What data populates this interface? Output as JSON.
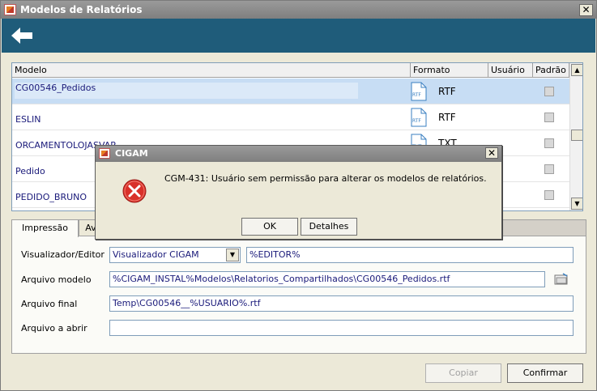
{
  "window": {
    "title": "Modelos de Relatórios",
    "close": "✕"
  },
  "grid": {
    "columns": [
      "Modelo",
      "Formato",
      "Usuário",
      "Padrão"
    ],
    "rows": [
      {
        "model": "CG00546_Pedidos",
        "format": "RTF",
        "selected": true
      },
      {
        "model": "ESLIN",
        "format": "RTF",
        "selected": false
      },
      {
        "model": "ORCAMENTOLOJASVAR",
        "format": "TXT",
        "selected": false
      },
      {
        "model": "Pedido",
        "format": "",
        "selected": false
      },
      {
        "model": "PEDIDO_BRUNO",
        "format": "",
        "selected": false
      }
    ],
    "scroll_up": "▲",
    "scroll_down": "▼"
  },
  "tabs": [
    {
      "label": "Impressão",
      "active": true
    },
    {
      "label": "Av",
      "active": false
    }
  ],
  "form": {
    "viewer_label": "Visualizador/Editor",
    "viewer_value": "Visualizador CIGAM",
    "viewer_arrow": "▼",
    "editor_value": "%EDITOR%",
    "model_file_label": "Arquivo modelo",
    "model_file_value": "%CIGAM_INSTAL%Modelos\\Relatorios_Compartilhados\\CG00546_Pedidos.rtf",
    "final_file_label": "Arquivo final",
    "final_file_value": "Temp\\CG00546__%USUARIO%.rtf",
    "open_file_label": "Arquivo a abrir",
    "open_file_value": ""
  },
  "buttons": {
    "copy": "Copiar",
    "confirm": "Confirmar"
  },
  "dialog": {
    "title": "CIGAM",
    "close": "✕",
    "message": "CGM-431: Usuário sem permissão para alterar os modelos de relatórios.",
    "ok": "OK",
    "details": "Detalhes"
  },
  "colors": {
    "header_band": "#1f5c7a",
    "selected_row": "#c7ddf4",
    "error_red": "#d9302a",
    "link_text": "#1a1a7a"
  }
}
